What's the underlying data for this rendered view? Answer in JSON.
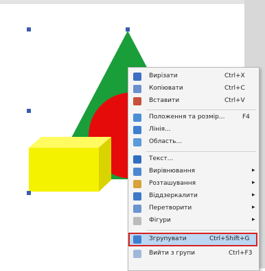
{
  "context_menu": {
    "items": [
      {
        "label": "Вирізати",
        "shortcut": "Ctrl+X",
        "icon": "scissors-icon",
        "color": "#3c6fc4"
      },
      {
        "label": "Копіювати",
        "shortcut": "Ctrl+C",
        "icon": "copy-icon",
        "color": "#6a8fd0"
      },
      {
        "label": "Вставити",
        "shortcut": "Ctrl+V",
        "icon": "paste-icon",
        "color": "#c7513a"
      },
      {
        "label": "Положення та розмір...",
        "shortcut": "F4",
        "icon": "position-size-icon",
        "color": "#4a8fd6"
      },
      {
        "label": "Лінія...",
        "shortcut": "",
        "icon": "line-icon",
        "color": "#3f7fd0"
      },
      {
        "label": "Область...",
        "shortcut": "",
        "icon": "area-icon",
        "color": "#5a9ad9"
      },
      {
        "label": "Текст...",
        "shortcut": "",
        "icon": "text-icon",
        "color": "#2f6fc0"
      },
      {
        "label": "Вирівнювання",
        "shortcut": "",
        "icon": "align-icon",
        "color": "#4c88d2"
      },
      {
        "label": "Розташування",
        "shortcut": "",
        "icon": "arrange-icon",
        "color": "#d8a13a"
      },
      {
        "label": "Віддзеркалити",
        "shortcut": "",
        "icon": "flip-icon",
        "color": "#3e79c8"
      },
      {
        "label": "Перетворити",
        "shortcut": "",
        "icon": "convert-icon",
        "color": "#6a95cf"
      },
      {
        "label": "Фігури",
        "shortcut": "",
        "icon": "shapes-icon",
        "color": "#bbbbbb"
      },
      {
        "label": "Згрупувати",
        "shortcut": "Ctrl+Shift+G",
        "icon": "group-icon",
        "color": "#3f7fd0"
      },
      {
        "label": "Вийти з групи",
        "shortcut": "Ctrl+F3",
        "icon": "exit-group-icon",
        "color": "#9fb8d8"
      }
    ],
    "highlighted_item": "Згрупувати",
    "highlight_border_color": "#d61f1f",
    "highlight_fill_color": "#bcd7f2"
  },
  "shapes": [
    {
      "type": "triangle",
      "color": "#1a9e3a"
    },
    {
      "type": "circle",
      "color": "#e60b0b"
    },
    {
      "type": "cube",
      "color": "#f5f200"
    }
  ],
  "selection": {
    "handle_color": "#3a5bb0"
  }
}
